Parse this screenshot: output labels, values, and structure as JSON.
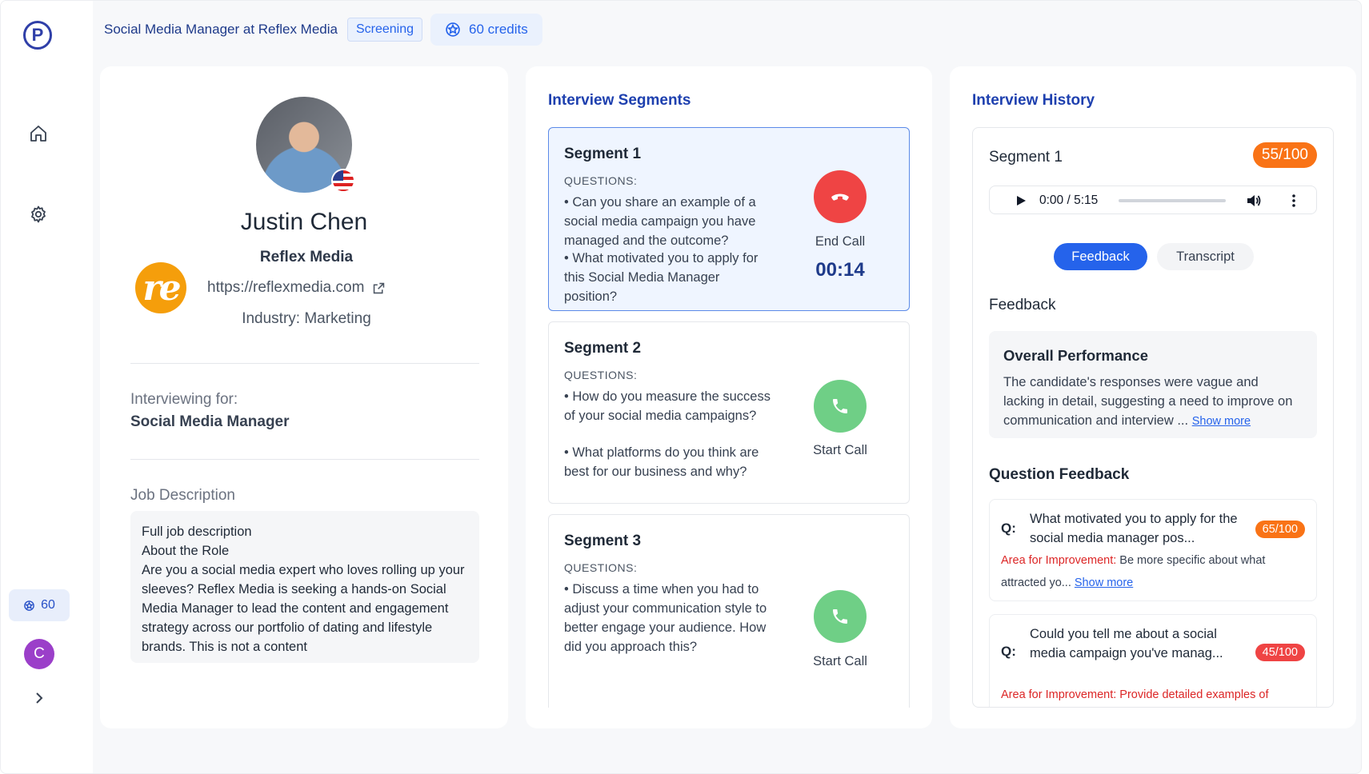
{
  "sidebar": {
    "logo_letter": "P",
    "credits": "60",
    "user_initial": "C"
  },
  "topbar": {
    "job_title": "Social Media Manager at Reflex Media",
    "status": "Screening",
    "credits": "60 credits"
  },
  "profile": {
    "name": "Justin Chen",
    "company": "Reflex Media",
    "company_logo_text": "re",
    "url": "https://reflexmedia.com",
    "industry": "Industry: Marketing",
    "interviewing_label": "Interviewing for:",
    "interviewing_role": "Social Media Manager",
    "jd_label": "Job Description",
    "jd_lines": [
      "Full job description",
      "About the Role",
      "Are you a social media expert who loves rolling up your sleeves? Reflex Media is seeking a hands-on Social Media Manager to lead the content and engagement strategy across our portfolio of dating and lifestyle brands. This is not a content"
    ]
  },
  "segments": {
    "title": "Interview Segments",
    "questions_label": "QUESTIONS:",
    "items": [
      {
        "title": "Segment 1",
        "questions": [
          "• Can you share an example of a social media campaign you have managed and the outcome?",
          "• What motivated you to apply for this Social Media Manager position?"
        ],
        "call_label": "End Call",
        "timer": "00:14"
      },
      {
        "title": "Segment 2",
        "questions": [
          "• How do you measure the success of your social media campaigns?",
          "• What platforms do you think are best for our business and why?"
        ],
        "call_label": "Start Call"
      },
      {
        "title": "Segment 3",
        "questions": [
          "• Discuss a time when you had to adjust your communication style to better engage your audience. How did you approach this?"
        ],
        "call_label": "Start Call"
      }
    ]
  },
  "history": {
    "title": "Interview History",
    "segment_title": "Segment 1",
    "score": "55/100",
    "player_time": "0:00 / 5:15",
    "tabs": [
      "Feedback",
      "Transcript"
    ],
    "feedback_heading": "Feedback",
    "overall_title": "Overall Performance",
    "overall_text": "The candidate's responses were vague and lacking in detail, suggesting a need to improve on communication and interview ...",
    "show_more": "Show more",
    "question_feedback_heading": "Question Feedback",
    "questions": [
      {
        "q_label": "Q:",
        "text": "What motivated you to apply for the social media manager pos...",
        "score": "65/100",
        "area_label": "Area for Improvement:",
        "area_text": "Be more specific about what attracted yo...",
        "show_more": "Show more"
      },
      {
        "q_label": "Q:",
        "text": "Could you tell me about a social media campaign you've manag...",
        "score": "45/100",
        "area_label": "Area for Improvement:",
        "area_text": "Provide detailed examples of"
      }
    ]
  },
  "colors": {
    "accent": "#2563eb",
    "end_call": "#ef4444",
    "start_call": "#6fcf86",
    "score_orange": "#f97316",
    "score_red": "#ef4444"
  }
}
